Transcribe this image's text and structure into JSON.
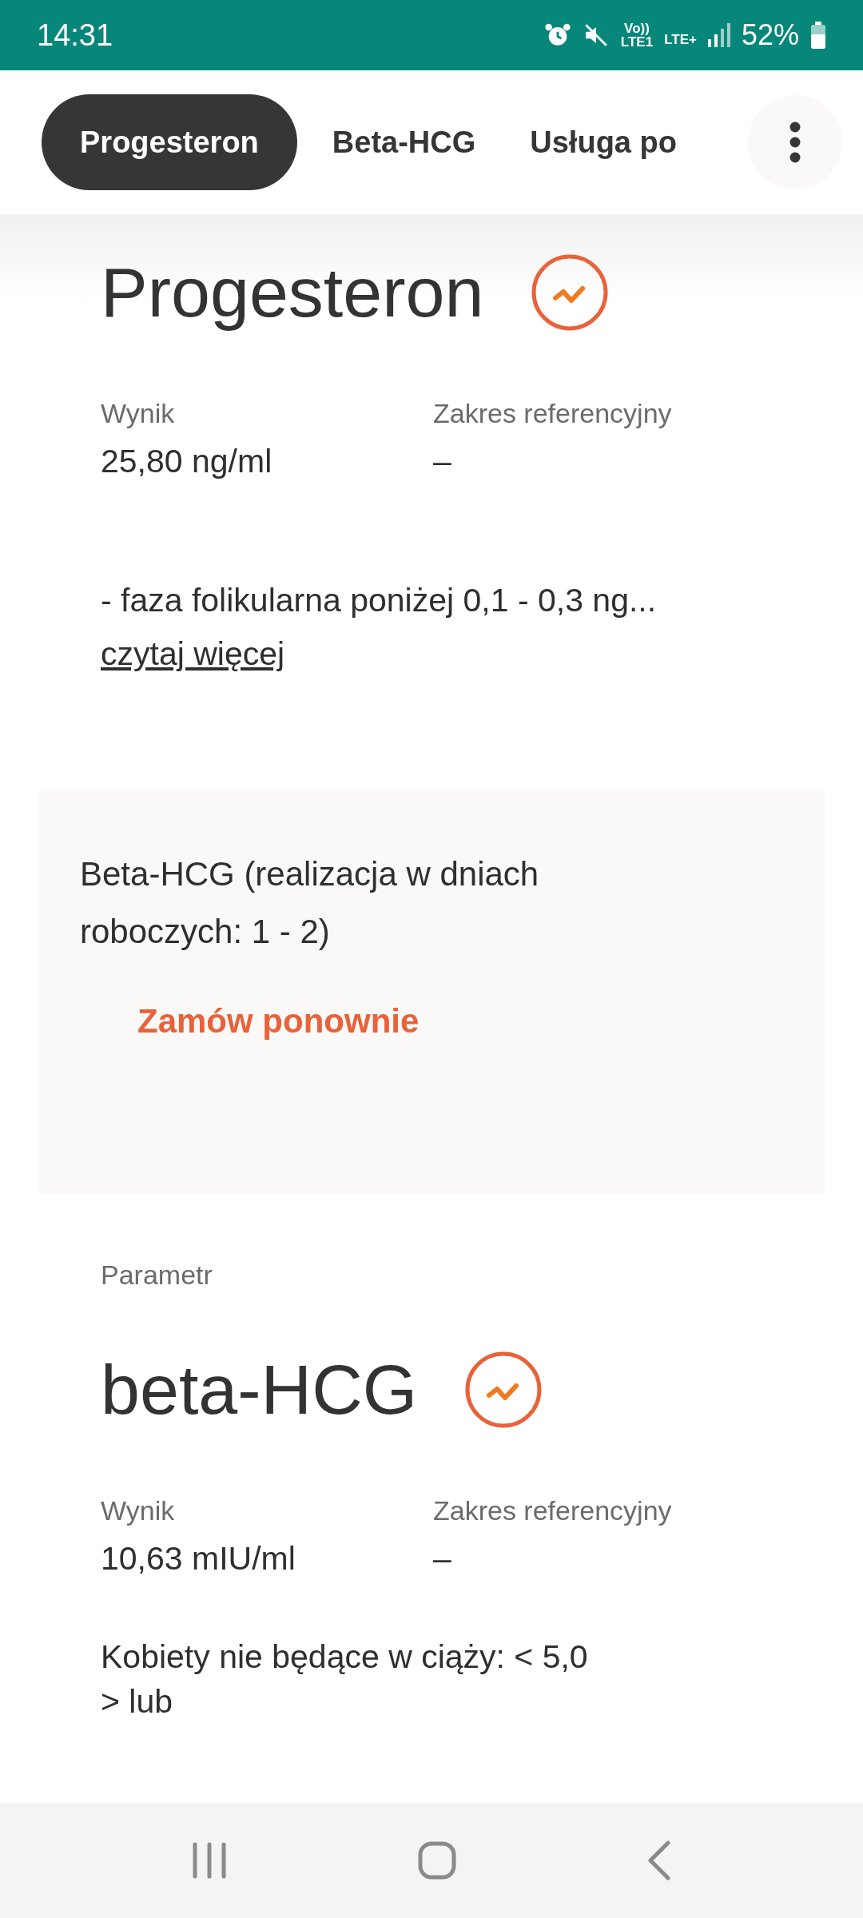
{
  "status_bar": {
    "time": "14:31",
    "volte": "Vo))",
    "lte1": "LTE1",
    "lte_plus": "LTE+",
    "battery": "52%"
  },
  "tabs": [
    {
      "label": "Progesteron",
      "selected": true
    },
    {
      "label": "Beta-HCG",
      "selected": false
    },
    {
      "label": "Usługa po",
      "selected": false
    }
  ],
  "results": [
    {
      "kind": "result",
      "title": "Progesteron",
      "result_label": "Wynik",
      "result_value": "25,80 ng/ml",
      "range_label": "Zakres referencyjny",
      "range_value": "–",
      "description": "- faza folikularna poniżej 0,1 - 0,3 ng...",
      "link": "czytaj więcej"
    }
  ],
  "order_card": {
    "text": "Beta-HCG (realizacja w dniach roboczych: 1 - 2)",
    "button": "Zamów ponownie"
  },
  "parameter": {
    "caption": "Parametr",
    "title": "beta-HCG",
    "result_label": "Wynik",
    "result_value": "10,63 mIU/ml",
    "range_label": "Zakres referencyjny",
    "range_value": "–",
    "description": [
      "Kobiety nie będące w ciąży: < 5,0",
      "> lub"
    ]
  }
}
